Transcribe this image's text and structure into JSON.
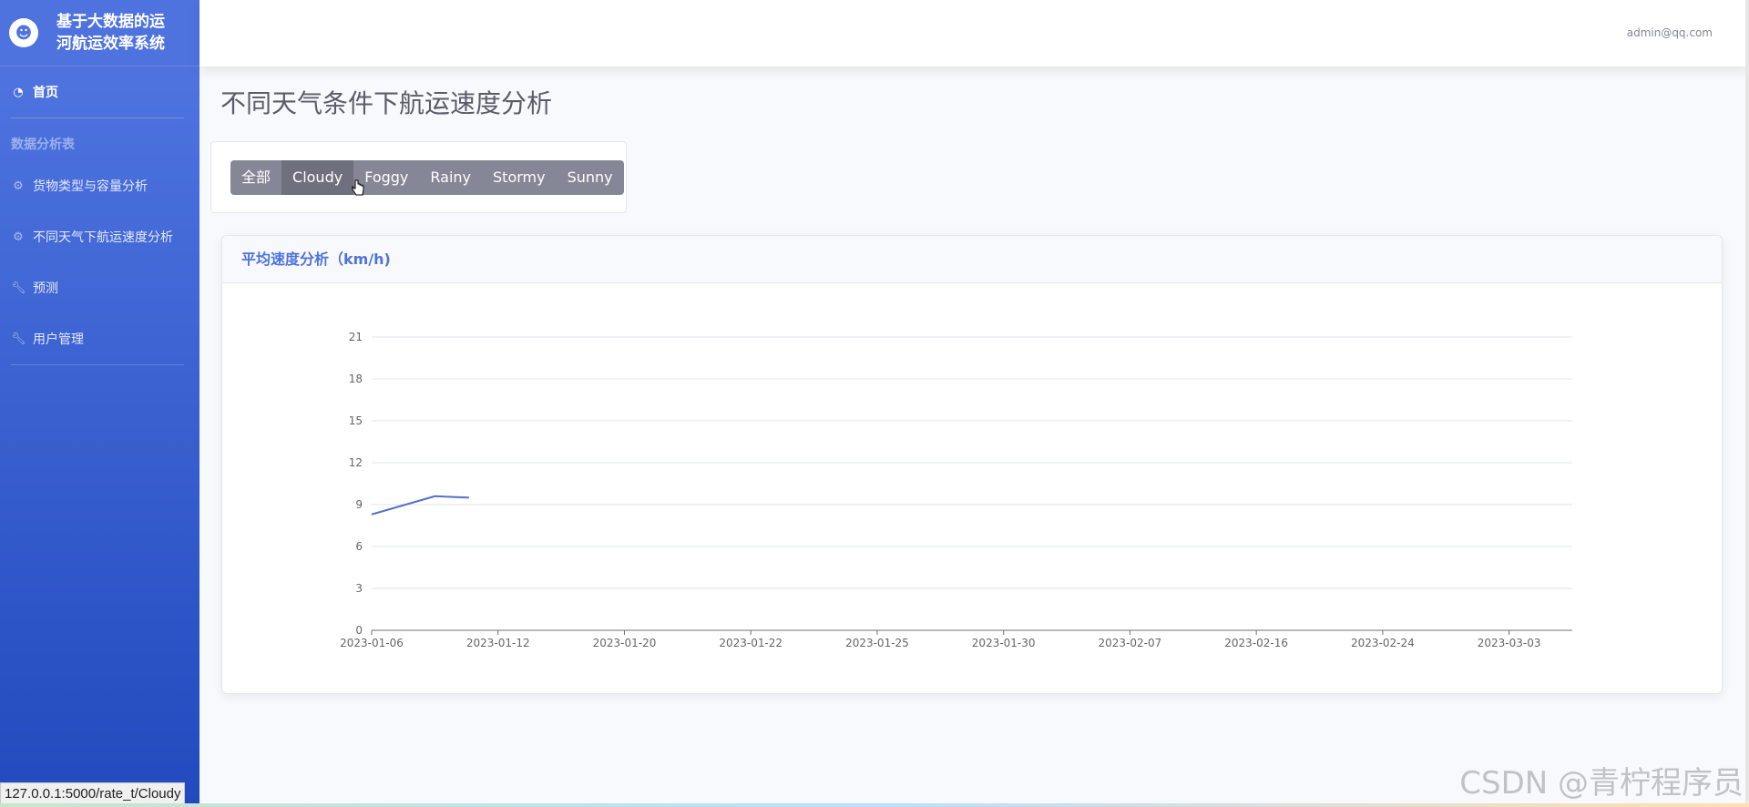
{
  "sidebar": {
    "brand": "基于大数据的运河航运效率系统",
    "items_top": [
      {
        "label": "首页",
        "icon": "dashboard-icon"
      }
    ],
    "heading": "数据分析表",
    "items_mid": [
      {
        "label": "货物类型与容量分析",
        "icon": "gear-icon"
      },
      {
        "label": "不同天气下航运速度分析",
        "icon": "gear-icon"
      },
      {
        "label": "预测",
        "icon": "wrench-icon"
      },
      {
        "label": "用户管理",
        "icon": "wrench-icon"
      }
    ]
  },
  "topbar": {
    "user": "admin@qq.com"
  },
  "page": {
    "title": "不同天气条件下航运速度分析"
  },
  "filters": {
    "buttons": [
      "全部",
      "Cloudy",
      "Foggy",
      "Rainy",
      "Stormy",
      "Sunny"
    ],
    "active": "Cloudy"
  },
  "chart_card": {
    "title": "平均速度分析（km/h)"
  },
  "chart_data": {
    "type": "line",
    "categories": [
      "2023-01-06",
      "2023-01-12",
      "2023-01-20",
      "2023-01-22",
      "2023-01-25",
      "2023-01-30",
      "2023-02-07",
      "2023-02-16",
      "2023-02-24",
      "2023-03-03"
    ],
    "series": [
      {
        "values": [
          8.3,
          9.6,
          9.5
        ]
      }
    ],
    "ylim": [
      0,
      21
    ],
    "yticks": [
      0,
      3,
      6,
      9,
      12,
      15,
      18,
      21
    ],
    "grid": true,
    "line_color": "#5470c6"
  },
  "status_bar": {
    "url": "127.0.0.1:5000/rate_t/Cloudy"
  },
  "watermark": {
    "text": "CSDN @青柠程序员"
  }
}
